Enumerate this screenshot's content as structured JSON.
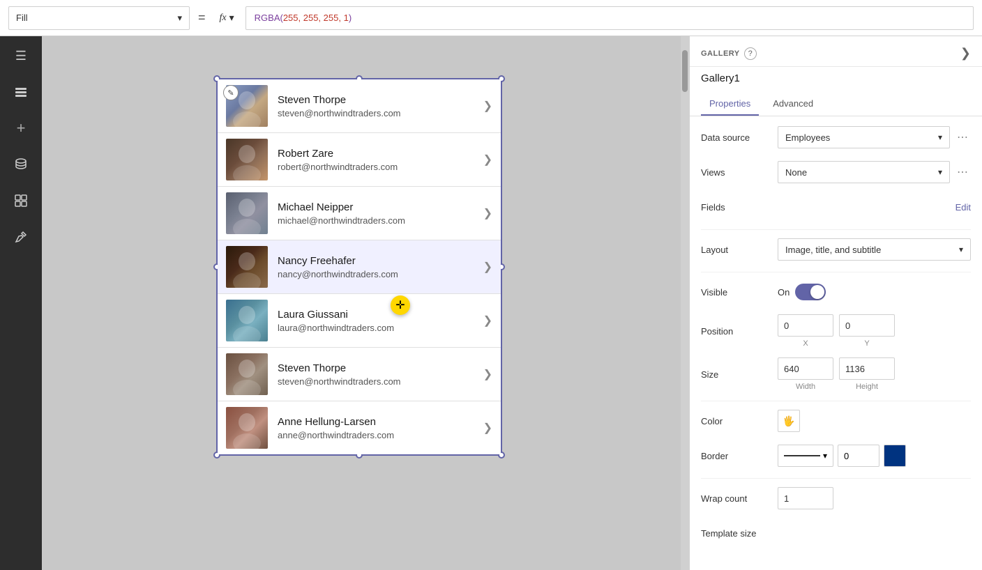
{
  "toolbar": {
    "fill_label": "Fill",
    "equals": "=",
    "fx_label": "fx",
    "formula": "RGBA(255, 255, 255, 1)",
    "formula_func": "RGBA",
    "formula_args": "255, 255, 255, 1"
  },
  "left_sidebar": {
    "icons": [
      {
        "name": "hamburger-icon",
        "glyph": "☰"
      },
      {
        "name": "layers-icon",
        "glyph": "⊞"
      },
      {
        "name": "plus-icon",
        "glyph": "+"
      },
      {
        "name": "database-icon",
        "glyph": "🗄"
      },
      {
        "name": "component-icon",
        "glyph": "⊡"
      },
      {
        "name": "tools-icon",
        "glyph": "🔧"
      }
    ]
  },
  "gallery": {
    "items": [
      {
        "name": "Steven Thorpe",
        "email": "steven@northwindtraders.com",
        "avatar_class": "avatar-1"
      },
      {
        "name": "Robert Zare",
        "email": "robert@northwindtraders.com",
        "avatar_class": "avatar-2"
      },
      {
        "name": "Michael Neipper",
        "email": "michael@northwindtraders.com",
        "avatar_class": "avatar-3"
      },
      {
        "name": "Nancy Freehafer",
        "email": "nancy@northwindtraders.com",
        "avatar_class": "avatar-4"
      },
      {
        "name": "Laura Giussani",
        "email": "laura@northwindtraders.com",
        "avatar_class": "avatar-5"
      },
      {
        "name": "Steven Thorpe",
        "email": "steven@northwindtraders.com",
        "avatar_class": "avatar-6"
      },
      {
        "name": "Anne Hellung-Larsen",
        "email": "anne@northwindtraders.com",
        "avatar_class": "avatar-7"
      }
    ]
  },
  "right_panel": {
    "section_label": "GALLERY",
    "help_tooltip": "?",
    "gallery_name": "Gallery1",
    "tabs": [
      {
        "id": "properties",
        "label": "Properties"
      },
      {
        "id": "advanced",
        "label": "Advanced"
      }
    ],
    "active_tab": "properties",
    "properties": {
      "data_source_label": "Data source",
      "data_source_value": "Employees",
      "views_label": "Views",
      "views_value": "None",
      "fields_label": "Fields",
      "fields_edit": "Edit",
      "layout_label": "Layout",
      "layout_value": "Image, title, and subtitle",
      "visible_label": "Visible",
      "visible_value": "On",
      "position_label": "Position",
      "position_x": "0",
      "position_y": "0",
      "position_x_label": "X",
      "position_y_label": "Y",
      "size_label": "Size",
      "size_width": "640",
      "size_height": "1136",
      "size_width_label": "Width",
      "size_height_label": "Height",
      "color_label": "Color",
      "color_icon": "🖐",
      "border_label": "Border",
      "border_value": "0",
      "wrap_count_label": "Wrap count",
      "wrap_count_value": "1",
      "template_label": "Template size"
    }
  }
}
